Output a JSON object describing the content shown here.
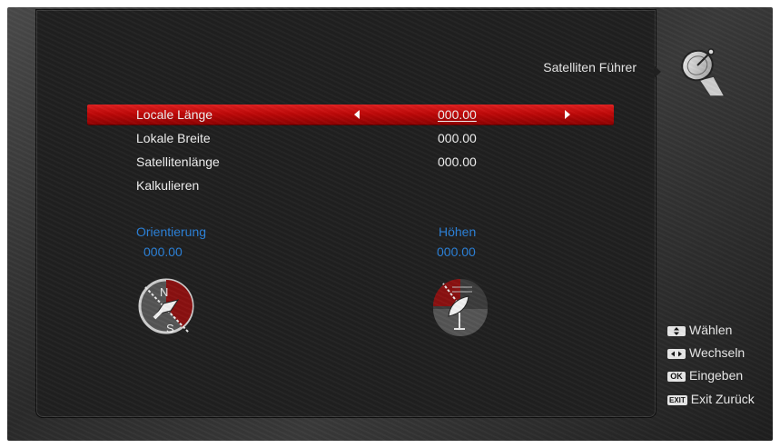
{
  "header": {
    "title": "Satelliten Führer"
  },
  "menu": {
    "items": [
      {
        "label": "Locale Länge",
        "value": "000.00",
        "selected": true
      },
      {
        "label": "Lokale Breite",
        "value": "000.00",
        "selected": false
      },
      {
        "label": "Satellitenlänge",
        "value": "000.00",
        "selected": false
      },
      {
        "label": "Kalkulieren",
        "value": "",
        "selected": false
      }
    ]
  },
  "results": {
    "orientation_label": "Orientierung",
    "orientation_value": "000.00",
    "elevation_label": "Höhen",
    "elevation_value": "000.00"
  },
  "hints": [
    {
      "key": "up-down-key-icon",
      "label": "Wählen"
    },
    {
      "key": "left-right-key-icon",
      "label": "Wechseln"
    },
    {
      "key": "OK",
      "label": "Eingeben"
    },
    {
      "key": "EXIT",
      "label": "Exit Zurück"
    }
  ],
  "colors": {
    "selection": "#c00808",
    "accent_blue": "#2a80d8",
    "panel": "#202020"
  }
}
